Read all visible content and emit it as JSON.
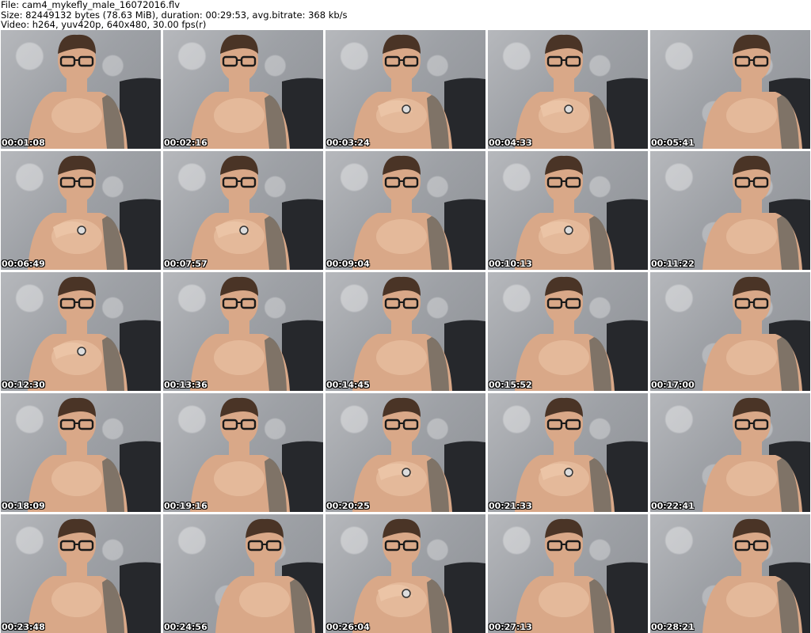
{
  "header": {
    "file_line": "File: cam4_mykefly_male_16072016.flv",
    "size_line": "Size: 82449132 bytes (78.63 MiB), duration: 00:29:53, avg.bitrate: 368 kb/s",
    "video_line": "Video: h264, yuv420p, 640x480, 30.00 fps(r)"
  },
  "thumbnails": [
    {
      "timestamp": "00:01:08",
      "pose": "center"
    },
    {
      "timestamp": "00:02:16",
      "pose": "center"
    },
    {
      "timestamp": "00:03:24",
      "pose": "hand-shoulder"
    },
    {
      "timestamp": "00:04:33",
      "pose": "hand-shoulder"
    },
    {
      "timestamp": "00:05:41",
      "pose": "right"
    },
    {
      "timestamp": "00:06:49",
      "pose": "hand-shoulder"
    },
    {
      "timestamp": "00:07:57",
      "pose": "hand-shoulder"
    },
    {
      "timestamp": "00:09:04",
      "pose": "center"
    },
    {
      "timestamp": "00:10:13",
      "pose": "hand-shoulder"
    },
    {
      "timestamp": "00:11:22",
      "pose": "right"
    },
    {
      "timestamp": "00:12:30",
      "pose": "hand-shoulder"
    },
    {
      "timestamp": "00:13:36",
      "pose": "center"
    },
    {
      "timestamp": "00:14:45",
      "pose": "center"
    },
    {
      "timestamp": "00:15:52",
      "pose": "center"
    },
    {
      "timestamp": "00:17:00",
      "pose": "right"
    },
    {
      "timestamp": "00:18:09",
      "pose": "center"
    },
    {
      "timestamp": "00:19:16",
      "pose": "center"
    },
    {
      "timestamp": "00:20:25",
      "pose": "hand-shoulder"
    },
    {
      "timestamp": "00:21:33",
      "pose": "hand-shoulder"
    },
    {
      "timestamp": "00:22:41",
      "pose": "right"
    },
    {
      "timestamp": "00:23:48",
      "pose": "center"
    },
    {
      "timestamp": "00:24:56",
      "pose": "right"
    },
    {
      "timestamp": "00:26:04",
      "pose": "hand-shoulder"
    },
    {
      "timestamp": "00:27:13",
      "pose": "center"
    },
    {
      "timestamp": "00:28:21",
      "pose": "right"
    }
  ],
  "colors": {
    "background": "#ffffff",
    "timestamp_text": "#ffffff",
    "timestamp_outline": "#000000",
    "skin": "#d9a888",
    "skin_light": "#ebc4a6",
    "hair": "#4a3426",
    "glasses": "#1a1a1a",
    "sofa": "#26282c",
    "tattoo": "#6e6a62"
  }
}
